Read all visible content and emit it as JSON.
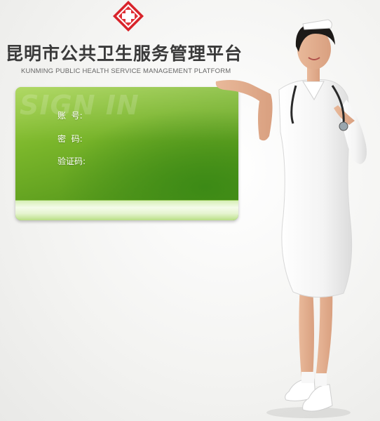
{
  "header": {
    "title": "昆明市公共卫生服务管理平台",
    "subtitle": "KUNMING PUBLIC HEALTH SERVICE MANAGEMENT PLATFORM",
    "logo_icon": "red-cross-icon"
  },
  "login": {
    "watermark": "SIGN IN",
    "account_label": "账  号:",
    "password_label": "密  码:",
    "captcha_label": "验证码:"
  },
  "colors": {
    "panel_green": "#5b9c1d",
    "logo_red": "#d8232a"
  }
}
